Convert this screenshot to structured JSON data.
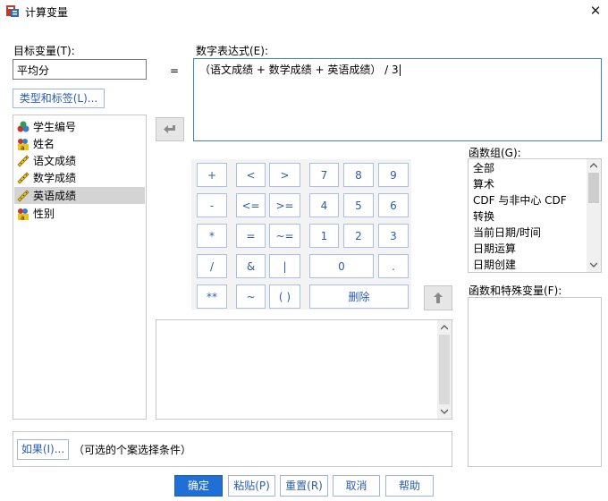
{
  "window": {
    "title": "计算变量",
    "close": "✕"
  },
  "target": {
    "label": "目标变量(T):",
    "value": "平均分",
    "type_label_button": "类型和标签(L)..."
  },
  "equals": "=",
  "expression": {
    "label": "数字表达式(E):",
    "value": "（语文成绩 + 数学成绩 + 英语成绩） / 3"
  },
  "variables": [
    {
      "name": "学生编号",
      "kind": "nominal"
    },
    {
      "name": "姓名",
      "kind": "string"
    },
    {
      "name": "语文成绩",
      "kind": "scale"
    },
    {
      "name": "数学成绩",
      "kind": "scale"
    },
    {
      "name": "英语成绩",
      "kind": "scale",
      "selected": true
    },
    {
      "name": "性别",
      "kind": "string"
    }
  ],
  "keypad": {
    "plus": "+",
    "lt": "<",
    "gt": ">",
    "k7": "7",
    "k8": "8",
    "k9": "9",
    "minus": "-",
    "le": "<=",
    "ge": ">=",
    "k4": "4",
    "k5": "5",
    "k6": "6",
    "mul": "*",
    "eq": "=",
    "ne": "~=",
    "k1": "1",
    "k2": "2",
    "k3": "3",
    "div": "/",
    "and": "&",
    "or": "|",
    "k0": "0",
    "dot": ".",
    "pow": "**",
    "not": "~",
    "paren": "( )",
    "delete": "删除"
  },
  "function_group": {
    "label": "函数组(G):",
    "items": [
      "全部",
      "算术",
      "CDF 与非中心 CDF",
      "转换",
      "当前日期/时间",
      "日期运算",
      "日期创建"
    ]
  },
  "functions_label": "函数和特殊变量(F):",
  "if_button": "如果(I)...",
  "if_hint": "（可选的个案选择条件）",
  "footer": {
    "ok": "确定",
    "paste": "粘贴(P)",
    "reset": "重置(R)",
    "cancel": "取消",
    "help": "帮助"
  }
}
